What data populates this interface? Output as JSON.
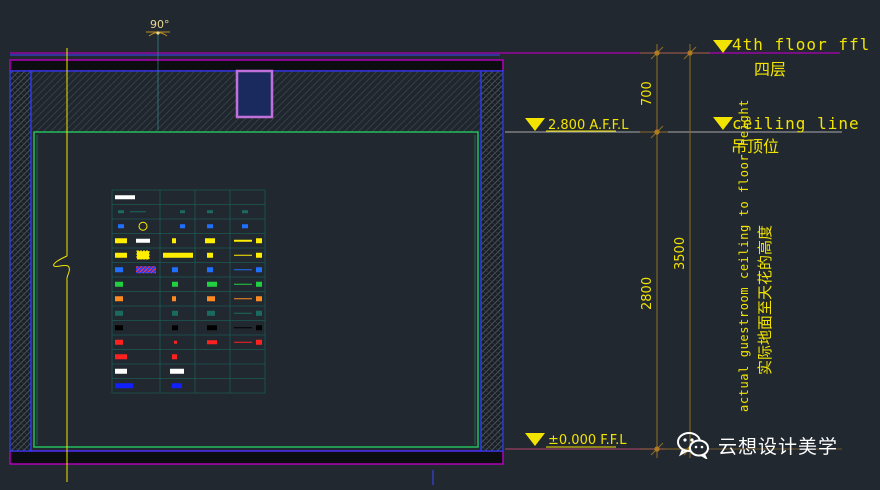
{
  "drawing": {
    "angle_marker": "90°",
    "levels": {
      "floor_4_en": "4th floor ffl",
      "floor_4_cn": "四层",
      "ceiling_line_en": "ceiling line",
      "ceiling_line_cn": "吊顶位",
      "ceiling_affl": "2.800 A.F.F.L",
      "floor_ffl": "±0.000 F.F.L"
    },
    "dimensions": {
      "upper": "700",
      "lower": "2800",
      "total": "3500"
    },
    "vertical_note_en": "actual guestroom ceiling to floor height",
    "vertical_note_cn": "实际地面至天花的高度",
    "legend_table": {
      "rows": 14,
      "cols": 4
    }
  },
  "watermark": {
    "text": "云想设计美学",
    "icon": "wechat-icon"
  },
  "colors": {
    "background": "#212830",
    "level_yellow": "#f2e400",
    "dimension_brown": "#8a6a26",
    "magenta": "#b000b8",
    "green": "#24c860",
    "blue_frame": "#2a3cff",
    "grid_teal": "#1b5a52"
  }
}
